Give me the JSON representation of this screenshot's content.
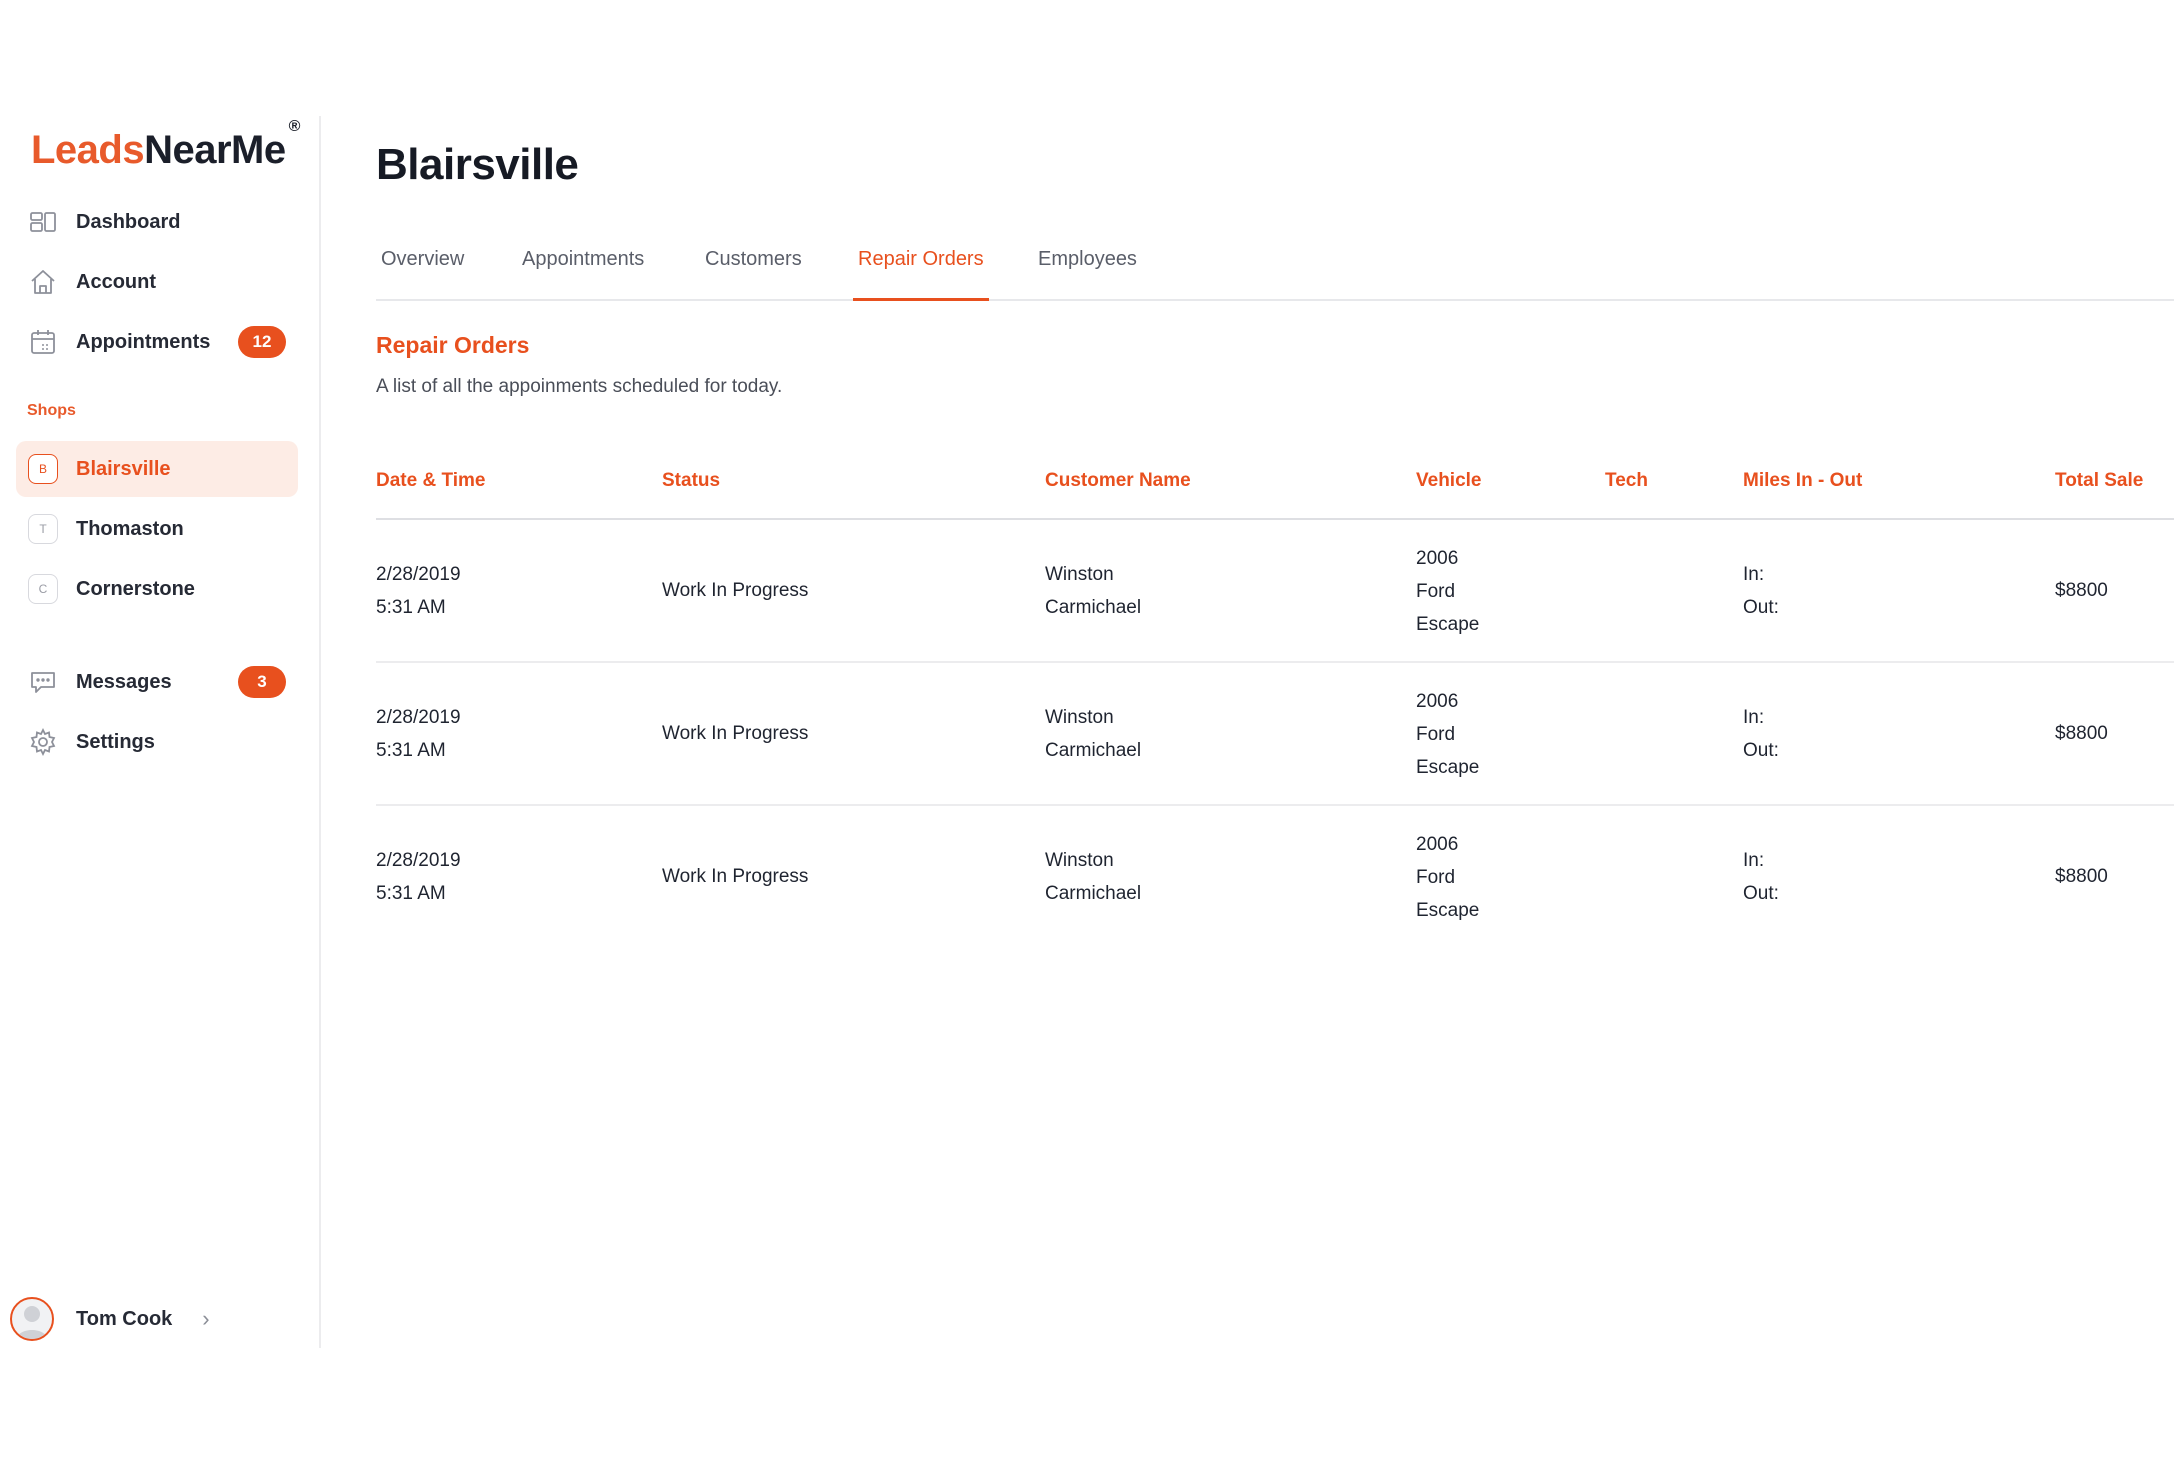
{
  "brand": {
    "name_part1": "Leads",
    "name_part2": "NearMe",
    "mark": "®",
    "accent": "#e8501e"
  },
  "nav": [
    {
      "label": "Dashboard",
      "icon": "dashboard-icon"
    },
    {
      "label": "Account",
      "icon": "home-icon"
    },
    {
      "label": "Appointments",
      "icon": "calendar-icon",
      "badge": "12"
    }
  ],
  "shops": {
    "label": "Shops",
    "items": [
      {
        "letter": "B",
        "label": "Blairsville",
        "active": true
      },
      {
        "letter": "T",
        "label": "Thomaston"
      },
      {
        "letter": "C",
        "label": "Cornerstone"
      }
    ]
  },
  "nav2": [
    {
      "label": "Messages",
      "icon": "chat-icon",
      "badge": "3"
    },
    {
      "label": "Settings",
      "icon": "gear-icon"
    }
  ],
  "user": {
    "name": "Tom Cook"
  },
  "page": {
    "title": "Blairsville"
  },
  "tabs": [
    {
      "label": "Overview"
    },
    {
      "label": "Appointments"
    },
    {
      "label": "Customers"
    },
    {
      "label": "Repair Orders",
      "active": true
    },
    {
      "label": "Employees"
    }
  ],
  "section": {
    "title": "Repair Orders",
    "subtitle": "A list of all the appoinments scheduled for today."
  },
  "table": {
    "headers": [
      "Date & Time",
      "Status",
      "Customer Name",
      "Vehicle",
      "Tech",
      "Miles In - Out",
      "Total Sale"
    ],
    "rows": [
      {
        "date": "2/28/2019",
        "time": "5:31 AM",
        "status": "Work In Progress",
        "customer_first": "Winston",
        "customer_last": "Carmichael",
        "vehicle_year": "2006",
        "vehicle_make": "Ford",
        "vehicle_model": "Escape",
        "tech": "",
        "miles_in": "In:",
        "miles_out": "Out:",
        "total": "$8800"
      },
      {
        "date": "2/28/2019",
        "time": "5:31 AM",
        "status": "Work In Progress",
        "customer_first": "Winston",
        "customer_last": "Carmichael",
        "vehicle_year": "2006",
        "vehicle_make": "Ford",
        "vehicle_model": "Escape",
        "tech": "",
        "miles_in": "In:",
        "miles_out": "Out:",
        "total": "$8800"
      },
      {
        "date": "2/28/2019",
        "time": "5:31 AM",
        "status": "Work In Progress",
        "customer_first": "Winston",
        "customer_last": "Carmichael",
        "vehicle_year": "2006",
        "vehicle_make": "Ford",
        "vehicle_model": "Escape",
        "tech": "",
        "miles_in": "In:",
        "miles_out": "Out:",
        "total": "$8800"
      }
    ]
  }
}
